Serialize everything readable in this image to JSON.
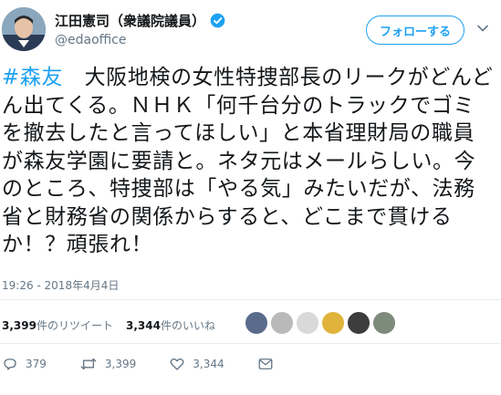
{
  "author": {
    "name": "江田憲司（衆議院議員）",
    "handle": "@edaoffice"
  },
  "follow_label": "フォローする",
  "tweet": {
    "hashtag": "#森友",
    "body": "　大阪地検の女性特捜部長のリークがどんどん出てくる。ＮＨＫ「何千台分のトラックでゴミを撤去したと言ってほしい」と本省理財局の職員が森友学園に要請と。ネタ元はメールらしい。今のところ、特捜部は「やる気」みたいだが、法務省と財務省の関係からすると、どこまで貫けるか！？頑張れ！",
    "timestamp": "19:26 - 2018年4月4日"
  },
  "stats": {
    "retweets_count": "3,399",
    "retweets_label": "件のリツイート",
    "likes_count": "3,344",
    "likes_label": "件のいいね"
  },
  "actions": {
    "reply_count": "379",
    "retweet_count": "3,399",
    "like_count": "3,344"
  },
  "colors": {
    "accent": "#1da1f2",
    "secondary_text": "#657786",
    "divider": "#e6ecf0"
  }
}
